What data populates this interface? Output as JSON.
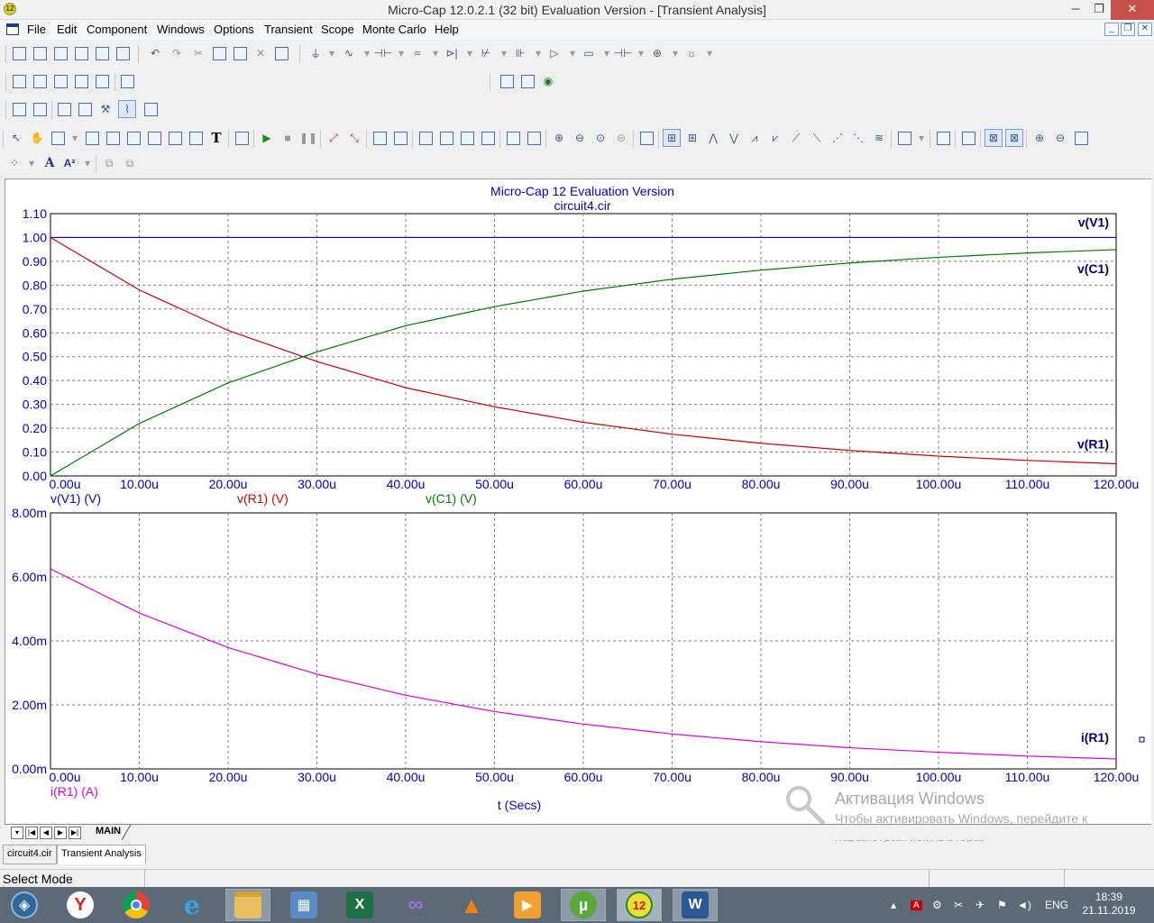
{
  "window": {
    "title": "Micro-Cap 12.0.2.1 (32 bit) Evaluation Version - [Transient Analysis]",
    "app_icon_text": "12"
  },
  "menu": [
    "File",
    "Edit",
    "Component",
    "Windows",
    "Options",
    "Transient",
    "Scope",
    "Monte Carlo",
    "Help"
  ],
  "plot": {
    "title": "Micro-Cap 12 Evaluation Version",
    "subtitle": "circuit4.cir",
    "x_axis_title": "t (Secs)",
    "x_ticks": [
      "0.00u",
      "10.00u",
      "20.00u",
      "30.00u",
      "40.00u",
      "50.00u",
      "60.00u",
      "70.00u",
      "80.00u",
      "90.00u",
      "100.00u",
      "110.00u",
      "120.00u"
    ],
    "upper_y_ticks": [
      "0.00",
      "0.10",
      "0.20",
      "0.30",
      "0.40",
      "0.50",
      "0.60",
      "0.70",
      "0.80",
      "0.90",
      "1.00",
      "1.10"
    ],
    "lower_y_ticks": [
      "0.00m",
      "2.00m",
      "4.00m",
      "6.00m",
      "8.00m"
    ],
    "upper_legend": [
      "v(V1) (V)",
      "v(R1) (V)",
      "v(C1) (V)"
    ],
    "lower_legend": [
      "i(R1) (A)"
    ],
    "curve_labels": {
      "v1": "v(V1)",
      "c1": "v(C1)",
      "r1": "v(R1)",
      "ir1": "i(R1)"
    },
    "colors": {
      "axis_text": "#0000cc",
      "v1": "#0000cc",
      "r1": "#cc0000",
      "c1": "#007a00",
      "ir1": "#dd00dd",
      "label": "#000080"
    }
  },
  "chart_data": [
    {
      "type": "line",
      "xlim": [
        0,
        120
      ],
      "ylim": [
        0,
        1.1
      ],
      "grid": true,
      "xlabel": "t (Secs)",
      "series": [
        {
          "name": "v(V1)",
          "x": [
            0,
            120
          ],
          "y": [
            1.0,
            1.0
          ]
        },
        {
          "name": "v(R1)",
          "x": [
            0,
            10,
            20,
            30,
            40,
            50,
            60,
            70,
            80,
            90,
            100,
            110,
            120
          ],
          "y": [
            1.0,
            0.78,
            0.61,
            0.48,
            0.37,
            0.29,
            0.225,
            0.175,
            0.137,
            0.107,
            0.083,
            0.065,
            0.051
          ]
        },
        {
          "name": "v(C1)",
          "x": [
            0,
            10,
            20,
            30,
            40,
            50,
            60,
            70,
            80,
            90,
            100,
            110,
            120
          ],
          "y": [
            0.0,
            0.22,
            0.39,
            0.52,
            0.63,
            0.71,
            0.775,
            0.825,
            0.863,
            0.893,
            0.917,
            0.935,
            0.949
          ]
        }
      ]
    },
    {
      "type": "line",
      "xlim": [
        0,
        120
      ],
      "ylim": [
        0,
        8.0
      ],
      "grid": true,
      "xlabel": "t (Secs)",
      "series": [
        {
          "name": "i(R1)",
          "x": [
            0,
            10,
            20,
            30,
            40,
            50,
            60,
            70,
            80,
            90,
            100,
            110,
            120
          ],
          "y": [
            6.25,
            4.87,
            3.79,
            2.96,
            2.3,
            1.79,
            1.4,
            1.09,
            0.85,
            0.66,
            0.52,
            0.4,
            0.31
          ]
        }
      ]
    }
  ],
  "sheet_tab": "MAIN",
  "doc_tabs": [
    "circuit4.cir",
    "Transient Analysis"
  ],
  "status": {
    "mode": "Select Mode"
  },
  "watermark": {
    "title": "Активация Windows",
    "line1": "Чтобы активировать Windows, перейдите к",
    "line2": "параметрам компьютера."
  },
  "taskbar": {
    "lang": "ENG",
    "time": "18:39",
    "date": "21.11.2019",
    "apps": [
      "Yandex Browser",
      "Chrome",
      "Internet Explorer",
      "File Explorer",
      "Control Panel",
      "Excel",
      "Visual Studio",
      "VLC",
      "Video Player",
      "uTorrent",
      "Micro-Cap 12",
      "Word"
    ]
  }
}
